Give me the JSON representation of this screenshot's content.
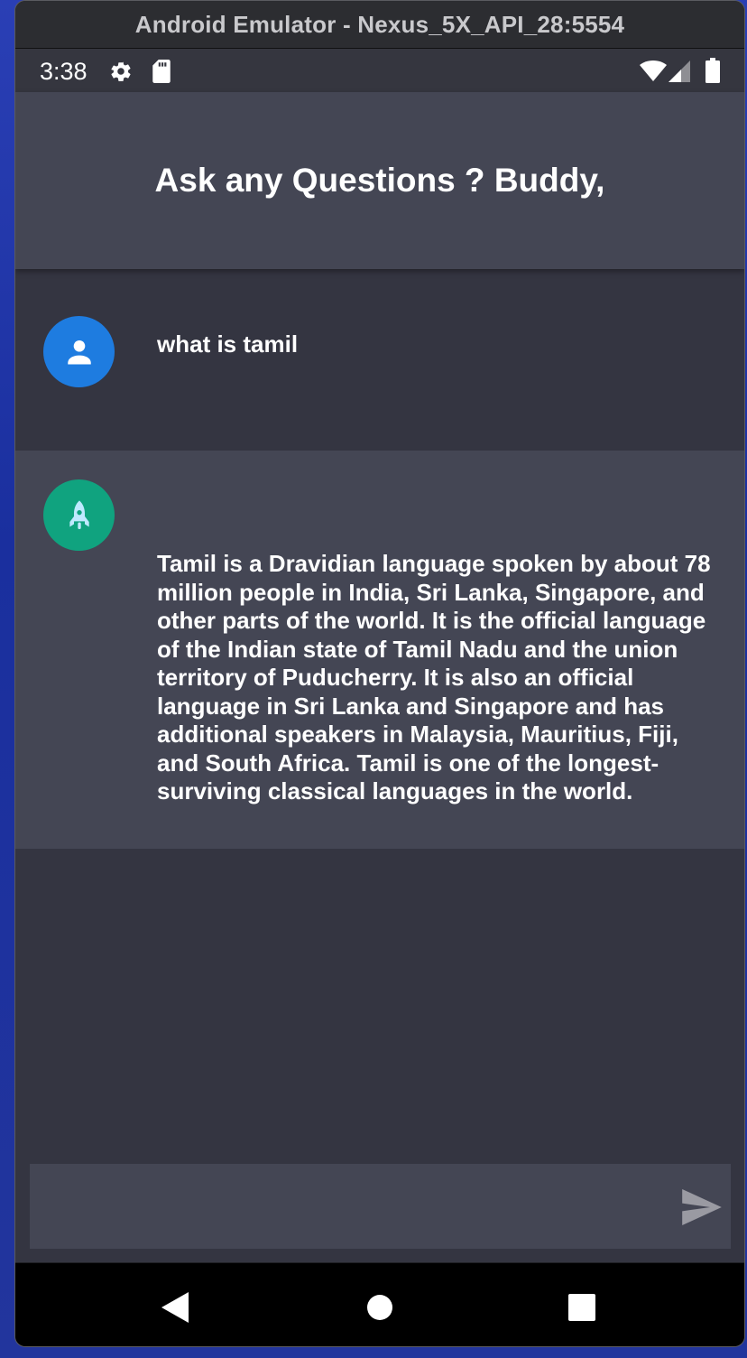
{
  "window": {
    "title": "Android Emulator - Nexus_5X_API_28:5554"
  },
  "statusbar": {
    "time": "3:38",
    "icons": [
      "gear-icon",
      "sd-card-icon",
      "wifi-icon",
      "signal-icon",
      "battery-icon"
    ]
  },
  "appbar": {
    "title": "Ask any Questions ? Buddy,"
  },
  "messages": [
    {
      "role": "user",
      "avatar_icon": "person-icon",
      "avatar_color": "#1e7ce0",
      "text": "what is tamil"
    },
    {
      "role": "bot",
      "avatar_icon": "rocket-icon",
      "avatar_color": "#10a37f",
      "text": "Tamil is a Dravidian language spoken by about 78 million people in India, Sri Lanka, Singapore, and other parts of the world. It is the official language of the Indian state of Tamil Nadu and the union territory of Puducherry. It is also an official language in Sri Lanka and Singapore and has additional speakers in Malaysia, Mauritius, Fiji, and South Africa. Tamil is one of the longest-surviving classical languages in the world."
    }
  ],
  "input": {
    "value": "",
    "send_icon": "send-icon"
  },
  "navbar": {
    "icons": [
      "back-icon",
      "home-icon",
      "recents-icon"
    ]
  },
  "colors": {
    "appbar_bg": "#444654",
    "chat_bg": "#343541",
    "user_avatar": "#1e7ce0",
    "bot_avatar": "#10a37f"
  }
}
